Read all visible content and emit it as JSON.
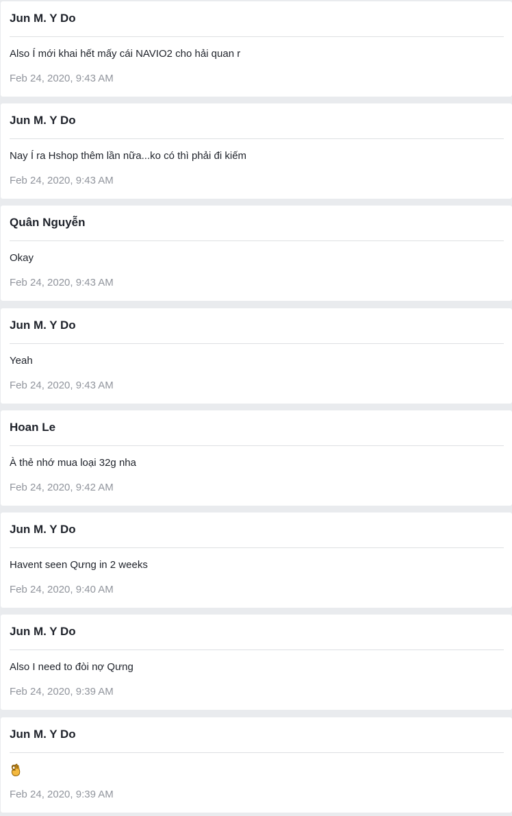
{
  "messages": [
    {
      "sender": "Jun M. Y Do",
      "text": "Also Í mới khai hết mấy cái NAVIO2 cho hải quan r",
      "time": "Feb 24, 2020, 9:43 AM"
    },
    {
      "sender": "Jun M. Y Do",
      "text": "Nay Í ra Hshop thêm lần nữa...ko có thì phải đi kiếm",
      "time": "Feb 24, 2020, 9:43 AM"
    },
    {
      "sender": "Quân Nguyễn",
      "text": "Okay",
      "time": "Feb 24, 2020, 9:43 AM"
    },
    {
      "sender": "Jun M. Y Do",
      "text": "Yeah",
      "time": "Feb 24, 2020, 9:43 AM"
    },
    {
      "sender": "Hoan Le",
      "text": "À thẻ nhớ mua loại 32g nha",
      "time": "Feb 24, 2020, 9:42 AM"
    },
    {
      "sender": "Jun M. Y Do",
      "text": "Havent seen Qưng in 2 weeks",
      "time": "Feb 24, 2020, 9:40 AM"
    },
    {
      "sender": "Jun M. Y Do",
      "text": "Also I need to đòi nợ Qưng",
      "time": "Feb 24, 2020, 9:39 AM"
    },
    {
      "sender": "Jun M. Y Do",
      "text": "",
      "icon": "ok-hand-emoji-icon",
      "time": "Feb 24, 2020, 9:39 AM"
    }
  ]
}
